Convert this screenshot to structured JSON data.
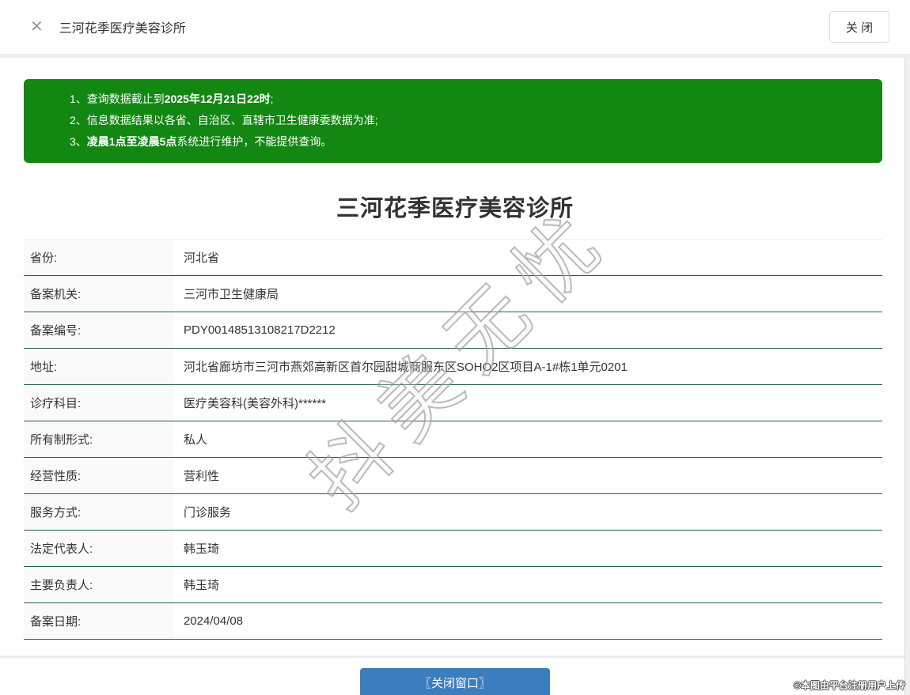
{
  "header": {
    "close_icon": "✕",
    "title": "三河花季医疗美容诊所",
    "close_button_label": "关 闭"
  },
  "notice": {
    "lines": [
      {
        "pre": "1、查询数据截止到",
        "bold": "2025年12月21日22时",
        "post": ";"
      },
      {
        "pre": "2、信息数据结果以各省、自治区、直辖市卫生健康委数据为准;",
        "bold": "",
        "post": ""
      },
      {
        "pre": "3、",
        "bold": "凌晨1点至凌晨5点",
        "post": "系统进行维护，不能提供查询。"
      }
    ]
  },
  "main": {
    "title": "三河花季医疗美容诊所",
    "rows": [
      {
        "label": "省份:",
        "value": "河北省"
      },
      {
        "label": "备案机关:",
        "value": "三河市卫生健康局"
      },
      {
        "label": "备案编号:",
        "value": "PDY00148513108217D2212"
      },
      {
        "label": "地址:",
        "value": "河北省廊坊市三河市燕郊高新区首尔园甜城商服东区SOHO2区项目A-1#栋1单元0201"
      },
      {
        "label": "诊疗科目:",
        "value": "医疗美容科(美容外科)******"
      },
      {
        "label": "所有制形式:",
        "value": "私人"
      },
      {
        "label": "经营性质:",
        "value": "营利性"
      },
      {
        "label": "服务方式:",
        "value": "门诊服务"
      },
      {
        "label": "法定代表人:",
        "value": "韩玉琦"
      },
      {
        "label": "主要负责人:",
        "value": "韩玉琦"
      },
      {
        "label": "备案日期:",
        "value": "2024/04/08"
      }
    ],
    "close_window_button_label": "〖关闭窗口〗"
  },
  "watermark": {
    "diagonal_text": "抖美无忧",
    "credit_text": "©本图由平台注册用户上传"
  },
  "colors": {
    "banner_green": "#128712",
    "row_divider_green": "#25604c",
    "button_blue": "#3b7dbd"
  }
}
